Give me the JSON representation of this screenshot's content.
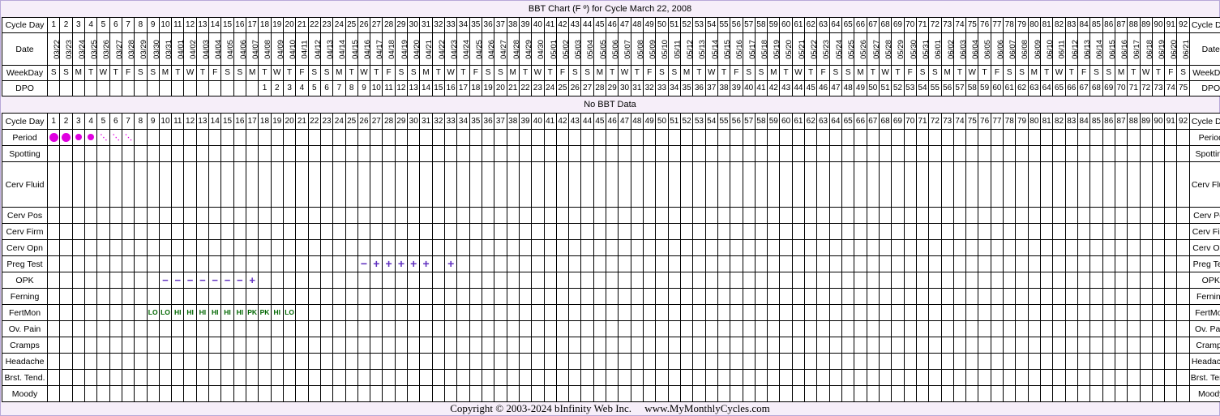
{
  "title": "BBT Chart (F º) for Cycle March 22, 2008",
  "no_bbt": "No BBT Data",
  "copyright": "Copyright © 2003-2024 bInfinity Web Inc.     www.MyMonthlyCycles.com",
  "labels": {
    "cycle_day": "Cycle Day",
    "date": "Date",
    "weekday": "WeekDay",
    "dpo": "DPO",
    "period": "Period",
    "spotting": "Spotting",
    "cerv_fluid": "Cerv Fluid",
    "cerv_pos": "Cerv Pos",
    "cerv_firm": "Cerv Firm",
    "cerv_opn": "Cerv Opn",
    "preg_test": "Preg Test",
    "opk": "OPK",
    "ferning": "Ferning",
    "fertmon": "FertMon",
    "ov_pain": "Ov. Pain",
    "cramps": "Cramps",
    "headache": "Headache",
    "brst_tend": "Brst. Tend.",
    "moody": "Moody"
  },
  "cycle_start": {
    "year": 2008,
    "month": 3,
    "day": 22
  },
  "num_days": 92,
  "dpo_start_day": 18,
  "weekday_letters": [
    "S",
    "M",
    "T",
    "W",
    "T",
    "F",
    "S"
  ],
  "period": {
    "1": "heavy",
    "2": "heavy",
    "3": "medium",
    "4": "medium",
    "5": "spotting",
    "6": "spotting",
    "7": "spotting"
  },
  "preg_test": {
    "26": "−",
    "27": "+",
    "28": "+",
    "29": "+",
    "30": "+",
    "31": "+",
    "33": "+"
  },
  "opk": {
    "10": "−",
    "11": "−",
    "12": "−",
    "13": "−",
    "14": "−",
    "15": "−",
    "16": "−",
    "17": "+"
  },
  "fertmon": {
    "9": "LO",
    "10": "LO",
    "11": "HI",
    "12": "HI",
    "13": "HI",
    "14": "HI",
    "15": "HI",
    "16": "HI",
    "17": "PK",
    "18": "PK",
    "19": "HI",
    "20": "LO"
  },
  "colors": {
    "frame_bg": "#f6eef9",
    "period": "#e000e0",
    "test_mark": "#6030c0",
    "fertmon": "#006600"
  }
}
